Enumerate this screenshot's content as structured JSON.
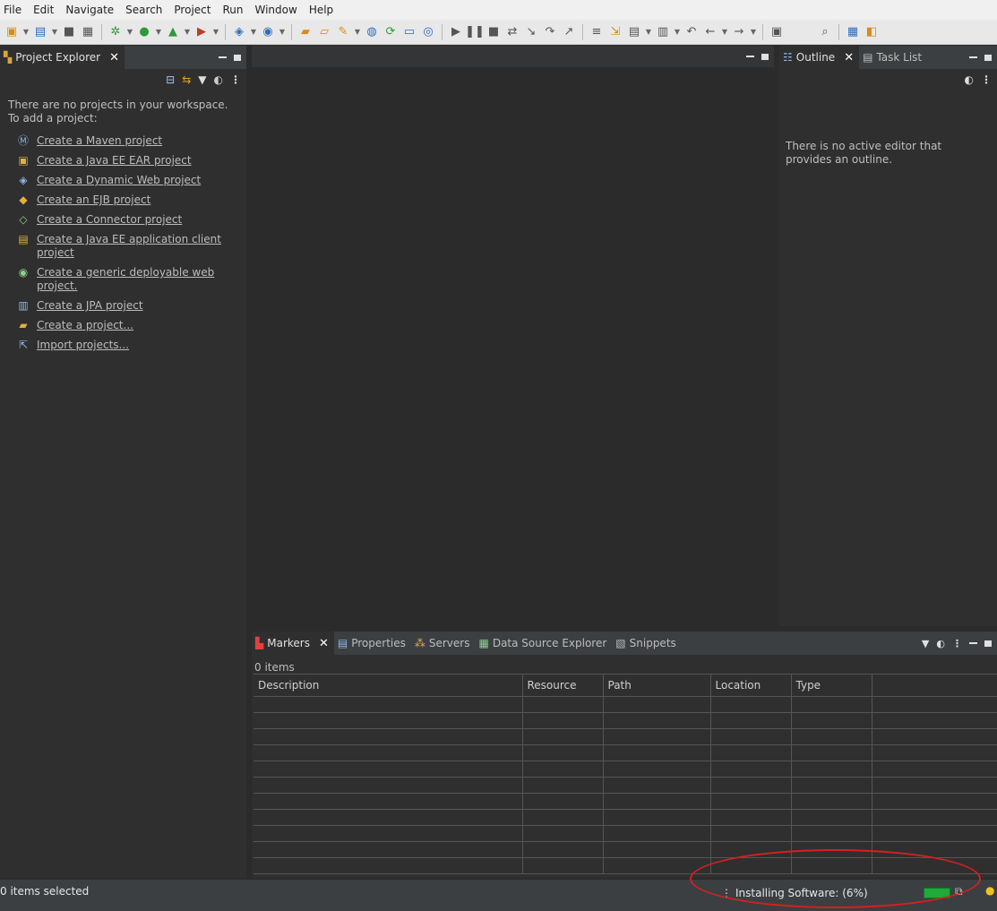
{
  "menu": [
    "File",
    "Edit",
    "Navigate",
    "Search",
    "Project",
    "Run",
    "Window",
    "Help"
  ],
  "project_explorer": {
    "title": "Project Explorer",
    "empty_line1": "There are no projects in your workspace.",
    "empty_line2": "To add a project:",
    "links": [
      {
        "label": "Create a Maven project",
        "icon": "maven-icon"
      },
      {
        "label": "Create a Java EE EAR project",
        "icon": "ear-icon"
      },
      {
        "label": "Create a Dynamic Web project",
        "icon": "web-project-icon"
      },
      {
        "label": "Create an EJB project",
        "icon": "ejb-icon"
      },
      {
        "label": "Create a Connector project",
        "icon": "connector-icon"
      },
      {
        "label": "Create a Java EE application client project",
        "icon": "app-client-icon"
      },
      {
        "label": "Create a generic deployable web project.",
        "icon": "generic-web-icon"
      },
      {
        "label": "Create a JPA project",
        "icon": "jpa-icon"
      },
      {
        "label": "Create a project...",
        "icon": "new-project-icon"
      },
      {
        "label": "Import projects...",
        "icon": "import-icon"
      }
    ]
  },
  "outline": {
    "tab_outline": "Outline",
    "tab_tasklist": "Task List",
    "message": "There is no active editor that provides an outline."
  },
  "bottom": {
    "tabs": [
      "Markers",
      "Properties",
      "Servers",
      "Data Source Explorer",
      "Snippets"
    ],
    "count": "0 items",
    "columns": [
      "Description",
      "Resource",
      "Path",
      "Location",
      "Type"
    ]
  },
  "status": {
    "selection": "0 items selected",
    "progress_text": "Installing Software: (6%)",
    "progress_percent": 6
  }
}
